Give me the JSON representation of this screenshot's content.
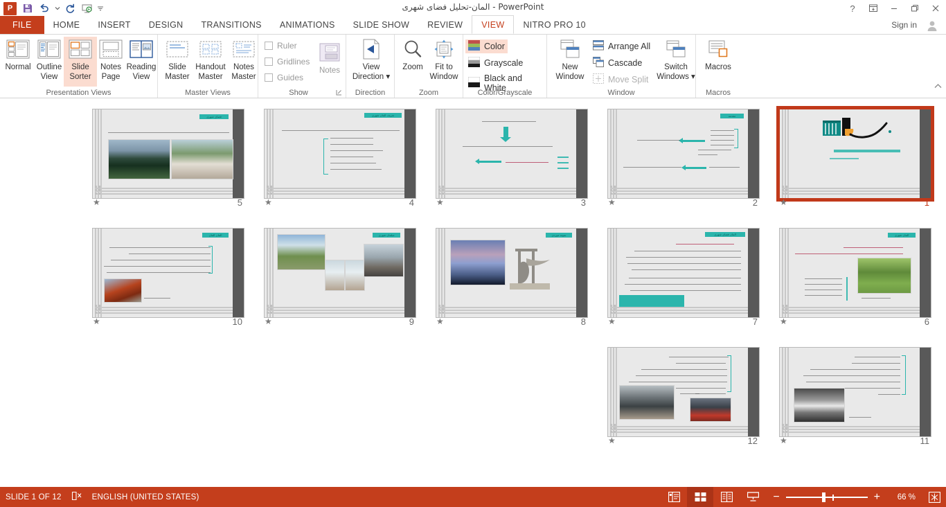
{
  "window": {
    "title": "المان-تحلیل فضای شهری - PowerPoint",
    "app_logo": "P",
    "help_icon": "?",
    "ribbon_display_icon": "ribbon-display-options",
    "minimize_icon": "–",
    "restore_icon": "restore",
    "close_icon": "✕",
    "sign_in": "Sign in",
    "avatar_icon": "account-avatar"
  },
  "quick_access": [
    {
      "name": "save-icon",
      "label": "Save"
    },
    {
      "name": "undo-icon",
      "label": "Undo"
    },
    {
      "name": "undo-dropdown-icon",
      "label": "Undo options"
    },
    {
      "name": "redo-icon",
      "label": "Redo"
    },
    {
      "name": "start-from-beginning-icon",
      "label": "Start From Beginning"
    },
    {
      "name": "customize-qat-icon",
      "label": "Customize Quick Access Toolbar"
    }
  ],
  "tabs": [
    {
      "label": "FILE",
      "type": "file"
    },
    {
      "label": "HOME",
      "type": "normal"
    },
    {
      "label": "INSERT",
      "type": "normal"
    },
    {
      "label": "DESIGN",
      "type": "normal"
    },
    {
      "label": "TRANSITIONS",
      "type": "normal"
    },
    {
      "label": "ANIMATIONS",
      "type": "normal"
    },
    {
      "label": "SLIDE SHOW",
      "type": "normal"
    },
    {
      "label": "REVIEW",
      "type": "normal"
    },
    {
      "label": "VIEW",
      "type": "active"
    },
    {
      "label": "NITRO PRO 10",
      "type": "normal"
    }
  ],
  "ribbon": {
    "collapse_icon": "^",
    "groups": [
      {
        "name": "presentation-views",
        "label": "Presentation Views",
        "buttons": [
          {
            "label_line1": "Normal",
            "label_line2": "",
            "icon": "normal-view-icon",
            "selected": false
          },
          {
            "label_line1": "Outline",
            "label_line2": "View",
            "icon": "outline-view-icon",
            "selected": false
          },
          {
            "label_line1": "Slide",
            "label_line2": "Sorter",
            "icon": "slide-sorter-icon",
            "selected": true
          },
          {
            "label_line1": "Notes",
            "label_line2": "Page",
            "icon": "notes-page-icon",
            "selected": false
          },
          {
            "label_line1": "Reading",
            "label_line2": "View",
            "icon": "reading-view-icon",
            "selected": false
          }
        ]
      },
      {
        "name": "master-views",
        "label": "Master Views",
        "buttons": [
          {
            "label_line1": "Slide",
            "label_line2": "Master",
            "icon": "slide-master-icon",
            "selected": false
          },
          {
            "label_line1": "Handout",
            "label_line2": "Master",
            "icon": "handout-master-icon",
            "selected": false
          },
          {
            "label_line1": "Notes",
            "label_line2": "Master",
            "icon": "notes-master-icon",
            "selected": false
          }
        ]
      },
      {
        "name": "show",
        "label": "Show",
        "checkboxes": [
          {
            "label": "Ruler",
            "checked": false
          },
          {
            "label": "Gridlines",
            "checked": false
          },
          {
            "label": "Guides",
            "checked": false
          }
        ],
        "buttons": [
          {
            "label_line1": "Notes",
            "label_line2": "",
            "icon": "notes-icon",
            "selected": false
          }
        ],
        "dialog_launcher": "show-dialog-launcher"
      },
      {
        "name": "direction",
        "label": "Direction",
        "buttons": [
          {
            "label_line1": "View",
            "label_line2": "Direction ▾",
            "icon": "view-direction-icon",
            "selected": false
          }
        ]
      },
      {
        "name": "zoom",
        "label": "Zoom",
        "buttons": [
          {
            "label_line1": "Zoom",
            "label_line2": "",
            "icon": "zoom-magnifier-icon",
            "selected": false
          },
          {
            "label_line1": "Fit to",
            "label_line2": "Window",
            "icon": "fit-to-window-icon",
            "selected": false
          }
        ]
      },
      {
        "name": "color-grayscale",
        "label": "Color/Grayscale",
        "items": [
          {
            "label": "Color",
            "icon": "color-swatch-icon",
            "selected": true,
            "disabled": false
          },
          {
            "label": "Grayscale",
            "icon": "grayscale-swatch-icon",
            "selected": false,
            "disabled": false
          },
          {
            "label": "Black and White",
            "icon": "black-white-swatch-icon",
            "selected": false,
            "disabled": false
          }
        ]
      },
      {
        "name": "window",
        "label": "Window",
        "buttons": [
          {
            "label_line1": "New",
            "label_line2": "Window",
            "icon": "new-window-icon",
            "selected": false
          },
          {
            "label_line1": "Switch",
            "label_line2": "Windows ▾",
            "icon": "switch-windows-icon",
            "selected": false
          }
        ],
        "items": [
          {
            "label": "Arrange All",
            "icon": "arrange-all-icon",
            "disabled": false
          },
          {
            "label": "Cascade",
            "icon": "cascade-icon",
            "disabled": false
          },
          {
            "label": "Move Split",
            "icon": "move-split-icon",
            "disabled": true
          }
        ]
      },
      {
        "name": "macros",
        "label": "Macros",
        "buttons": [
          {
            "label_line1": "Macros",
            "label_line2": "",
            "icon": "macros-icon",
            "selected": false
          }
        ]
      }
    ]
  },
  "slide_sorter": {
    "star_icon": "animation-star-icon",
    "slides": [
      {
        "number": "5",
        "row": 0,
        "col": 0,
        "selected": false,
        "layout": "two-photos",
        "badge": "فضای شهری"
      },
      {
        "number": "4",
        "row": 0,
        "col": 1,
        "selected": false,
        "layout": "bullet-list",
        "badge": "تعریف المان شهری"
      },
      {
        "number": "3",
        "row": 0,
        "col": 2,
        "selected": false,
        "layout": "arrow-diagram",
        "badge": ""
      },
      {
        "number": "2",
        "row": 0,
        "col": 3,
        "selected": false,
        "layout": "arrows-list",
        "badge": "مقدمه"
      },
      {
        "number": "1",
        "row": 0,
        "col": 4,
        "selected": true,
        "layout": "title-bismillah",
        "badge": ""
      },
      {
        "number": "10",
        "row": 1,
        "col": 0,
        "selected": false,
        "layout": "text-photo-left",
        "badge": "المان المان"
      },
      {
        "number": "9",
        "row": 1,
        "col": 1,
        "selected": false,
        "layout": "photo-collage",
        "badge": "مبلمان شهری"
      },
      {
        "number": "8",
        "row": 1,
        "col": 2,
        "selected": false,
        "layout": "two-monuments",
        "badge": "نمونه موردی"
      },
      {
        "number": "7",
        "row": 1,
        "col": 3,
        "selected": false,
        "layout": "text-heavy",
        "badge": "المان فضای شهری"
      },
      {
        "number": "6",
        "row": 1,
        "col": 4,
        "selected": false,
        "layout": "text-photo-right",
        "badge": "المان شهری"
      },
      {
        "number": "12",
        "row": 2,
        "col": 3,
        "selected": false,
        "layout": "text-two-photos",
        "badge": ""
      },
      {
        "number": "11",
        "row": 2,
        "col": 4,
        "selected": false,
        "layout": "text-photo-bw",
        "badge": ""
      }
    ]
  },
  "status_bar": {
    "slide_indicator": "SLIDE 1 OF 12",
    "spelling_icon": "spell-check-icon",
    "language": "ENGLISH (UNITED STATES)",
    "views": [
      {
        "name": "normal-view-button",
        "icon": "normal-view",
        "active": false
      },
      {
        "name": "slide-sorter-view-button",
        "icon": "slide-sorter-view",
        "active": true
      },
      {
        "name": "reading-view-button",
        "icon": "reading-view",
        "active": false
      },
      {
        "name": "slide-show-button",
        "icon": "slide-show",
        "active": false
      }
    ],
    "zoom_out": "−",
    "zoom_in": "+",
    "zoom_level": "66 %",
    "fit_window_icon": "fit-slide-to-window-icon"
  }
}
